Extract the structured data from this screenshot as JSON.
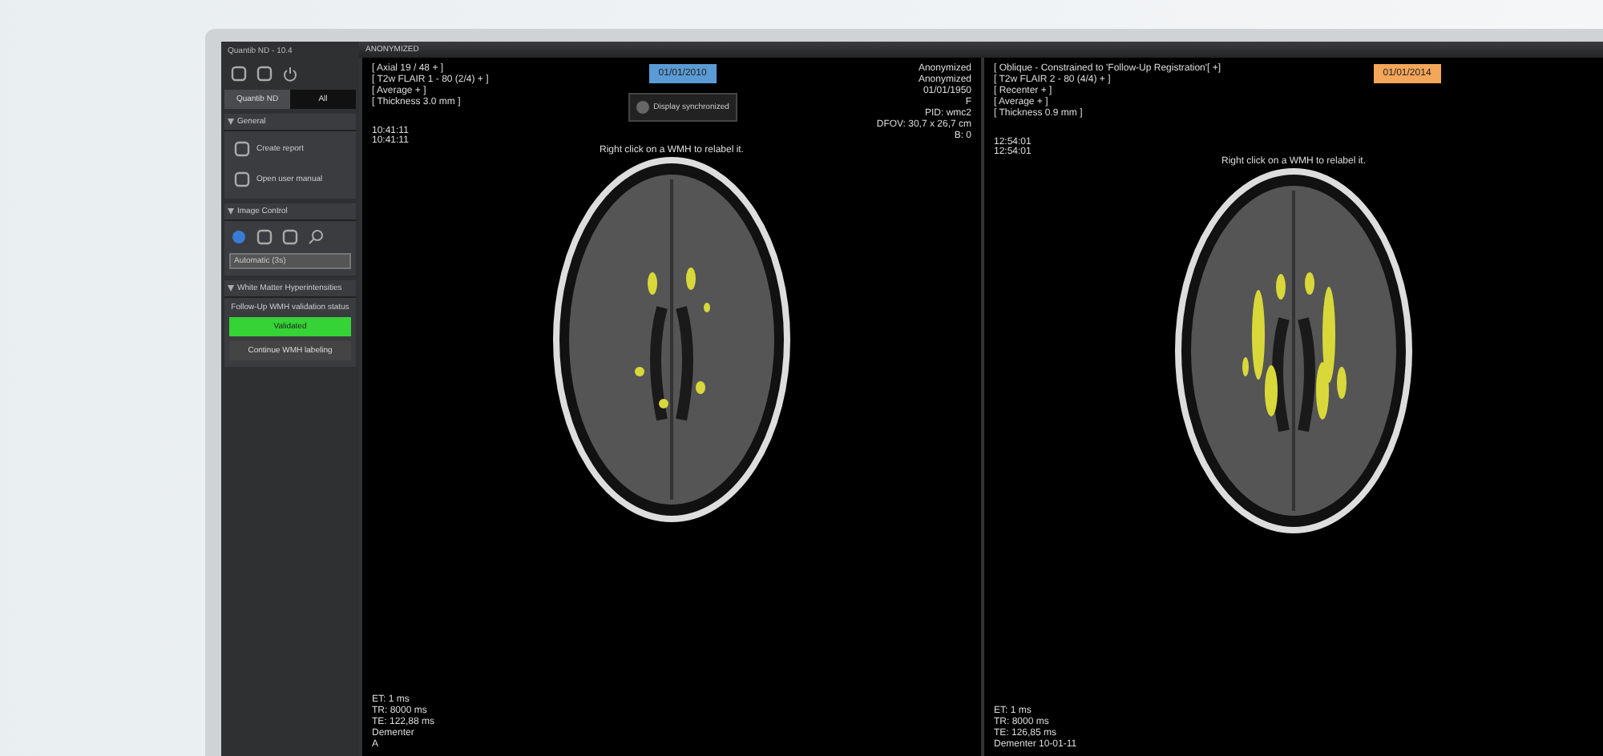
{
  "app": {
    "title": "Quantib ND - 10.4",
    "patient_bar": "ANONYMIZED"
  },
  "sidebar": {
    "tabs": [
      {
        "label": "Quantib ND",
        "selected": true
      },
      {
        "label": "All",
        "selected": false
      }
    ],
    "sections": [
      {
        "title": "General",
        "expanded": true,
        "kind": "actions",
        "items": [
          "Create report",
          "Open user manual"
        ]
      },
      {
        "title": "Image Control",
        "expanded": true,
        "kind": "tools",
        "dropdown": "Automatic (3s)"
      },
      {
        "title": "White Matter Hyperintensities",
        "expanded": true,
        "kind": "wmh",
        "status_label": "Follow-Up WMH validation status",
        "status": "Validated",
        "action": "Continue WMH labeling"
      }
    ]
  },
  "viewers": [
    {
      "info": [
        "[ Axial 19 / 48 + ]",
        "[ T2w FLAIR 1 - 80 (2/4) + ]",
        "[ Average + ]",
        "[ Thickness 3.0 mm ]"
      ],
      "times": [
        "10:41:11",
        "10:41:11"
      ],
      "date": "01/01/2010",
      "color": "#5b9bd5",
      "popup": "Display synchronized",
      "hint": "Right click on a WMH to relabel it.",
      "patient": [
        "Anonymized",
        "Anonymized",
        "01/01/1950",
        "F",
        "PID: wmc2",
        "DFOV: 30,7 x 26,7 cm",
        "B: 0"
      ],
      "params": [
        "ET: 1 ms",
        "TR: 8000 ms",
        "TE: 122,88 ms",
        "Dementer"
      ],
      "orientation": "A"
    },
    {
      "info": [
        "[ Oblique - Constrained to 'Follow-Up Registration'[ +]",
        "[ T2w FLAIR 2 - 80 (4/4) + ]",
        "[ Recenter + ]",
        "[ Average + ]",
        "[ Thickness 0.9 mm ]"
      ],
      "times": [
        "12:54:01",
        "12:54:01"
      ],
      "date": "01/01/2014",
      "color": "#f4a65a",
      "hint": "Right click on a WMH to relabel it.",
      "params": [
        "ET: 1 ms",
        "TR: 8000 ms",
        "TE: 126,85 ms",
        "Dementer  10-01-11"
      ]
    }
  ]
}
